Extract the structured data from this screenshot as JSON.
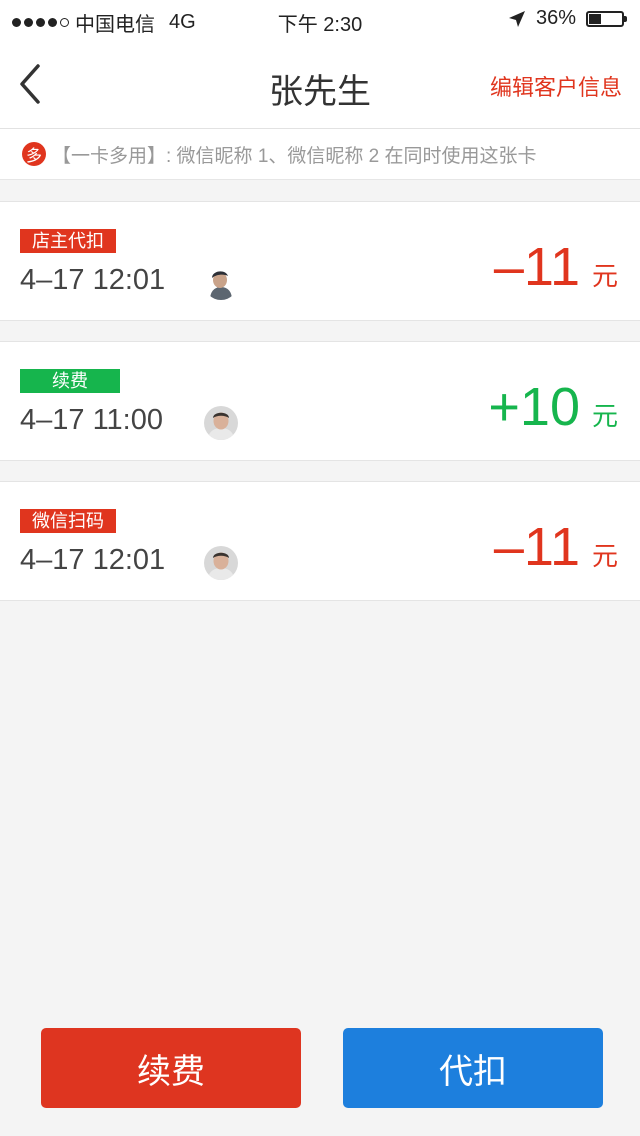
{
  "status_bar": {
    "carrier": "中国电信",
    "network": "4G",
    "time": "下午 2:30",
    "battery": "36%",
    "battery_level": 0.36
  },
  "nav": {
    "title": "张先生",
    "edit_label": "编辑客户信息"
  },
  "notice": {
    "badge": "多",
    "text": "【一卡多用】: 微信昵称 1、微信昵称 2 在同时使用这张卡"
  },
  "records": [
    {
      "tag": "店主代扣",
      "time": "4–17 12:01",
      "amount": "–11",
      "unit": "元"
    },
    {
      "tag": "续费",
      "time": "4–17 11:00",
      "amount": "+10",
      "unit": "元"
    },
    {
      "tag": "微信扫码",
      "time": "4–17 12:01",
      "amount": "–11",
      "unit": "元"
    }
  ],
  "buttons": {
    "renew": "续费",
    "deduct": "代扣"
  },
  "colors": {
    "accent_red": "#e0351e",
    "accent_green": "#16b54d",
    "accent_blue": "#1d7fdd"
  }
}
